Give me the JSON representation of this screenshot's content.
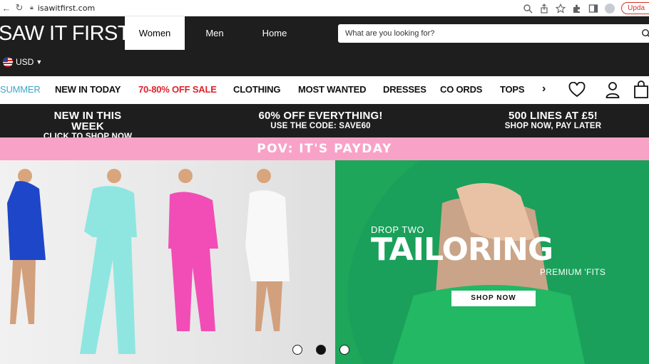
{
  "browser": {
    "url": "isawitfirst.com",
    "update_label": "Upda"
  },
  "header": {
    "logo": "SAW IT FIRST",
    "gender_tabs": [
      {
        "label": "Women",
        "active": true
      },
      {
        "label": "Men",
        "active": false
      },
      {
        "label": "Home",
        "active": false
      }
    ],
    "search_placeholder": "What are you looking for?",
    "currency": "USD"
  },
  "categories": [
    {
      "label": "SUMMER"
    },
    {
      "label": "NEW IN TODAY"
    },
    {
      "label": "70-80% OFF SALE"
    },
    {
      "label": "CLOTHING"
    },
    {
      "label": "MOST WANTED"
    },
    {
      "label": "DRESSES"
    },
    {
      "label": "CO ORDS"
    },
    {
      "label": "TOPS"
    }
  ],
  "promos": [
    {
      "title": "NEW IN THIS WEEK",
      "subtitle": "CLICK TO SHOP NOW"
    },
    {
      "title": "60% OFF EVERYTHING!",
      "subtitle": "USE THE CODE: SAVE60"
    },
    {
      "title": "500 LINES AT £5!",
      "subtitle": "SHOP NOW, PAY LATER"
    }
  ],
  "banner": "POV: IT'S PAYDAY",
  "hero": {
    "kicker": "DROP TWO",
    "headline": "TAILORING",
    "tagline": "PREMIUM 'FITS",
    "cta": "SHOP NOW",
    "active_slide": 2,
    "slide_count": 3
  },
  "colors": {
    "dark": "#1e1e1e",
    "sale_red": "#e0202b",
    "summer_blue": "#3ea6c9",
    "payday_pink": "#f9a2c8",
    "hero_green": "#1ea65a"
  }
}
